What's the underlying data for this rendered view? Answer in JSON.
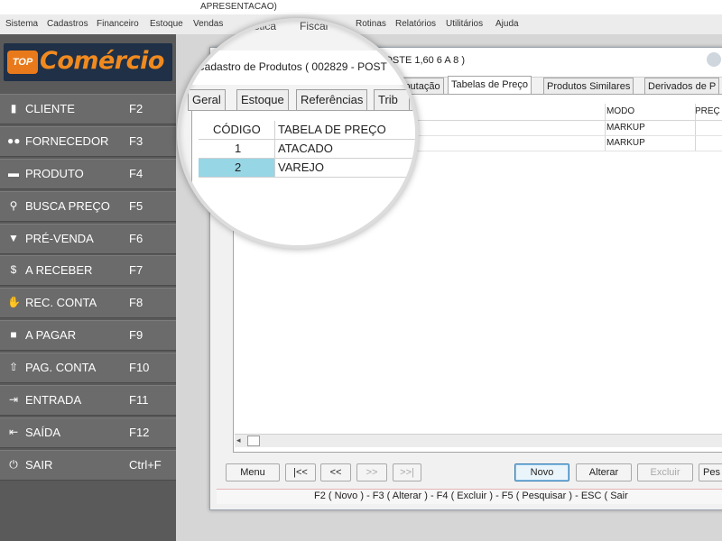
{
  "window_title_fragment": "APRESENTACAO)",
  "menubar": {
    "items": [
      "Sistema",
      "Cadastros",
      "Financeiro",
      "Estoque",
      "Vendas",
      "Logística",
      "Fiscal",
      "Rotinas",
      "Relatórios",
      "Utilitários",
      "Ajuda"
    ]
  },
  "logo": {
    "badge": "TOP",
    "brand": "Comércio"
  },
  "sidebar": {
    "items": [
      {
        "label": "CLIENTE",
        "key": "F2",
        "icon": "id-card-icon"
      },
      {
        "label": "FORNECEDOR",
        "key": "F3",
        "icon": "users-icon"
      },
      {
        "label": "PRODUTO",
        "key": "F4",
        "icon": "box-icon"
      },
      {
        "label": "BUSCA PREÇO",
        "key": "F5",
        "icon": "search-icon"
      },
      {
        "label": "PRÉ-VENDA",
        "key": "F6",
        "icon": "basket-icon"
      },
      {
        "label": "A RECEBER",
        "key": "F7",
        "icon": "dollar-icon"
      },
      {
        "label": "REC. CONTA",
        "key": "F8",
        "icon": "hand-money-icon"
      },
      {
        "label": "A PAGAR",
        "key": "F9",
        "icon": "wallet-icon"
      },
      {
        "label": "PAG. CONTA",
        "key": "F10",
        "icon": "upload-icon"
      },
      {
        "label": "ENTRADA",
        "key": "F11",
        "icon": "sign-in-icon"
      },
      {
        "label": "SAÍDA",
        "key": "F12",
        "icon": "sign-out-icon"
      },
      {
        "label": "SAIR",
        "key": "Ctrl+F",
        "icon": "power-icon"
      }
    ]
  },
  "form": {
    "title": "Cadastro de Produtos ( 002829 - POST",
    "title_right": "POSTE 1,60 6 A 8 )",
    "tabs": [
      "Geral",
      "Estoque",
      "Referências",
      "Tributação",
      "Tabelas de Preço",
      "Produtos Similares",
      "Derivados de P"
    ],
    "active_tab": "Tabelas de Preço",
    "grid": {
      "columns": [
        "CÓDIGO",
        "TABELA DE PREÇO",
        "MODO",
        "PREÇ"
      ],
      "rows": [
        {
          "codigo": "1",
          "tabela": "ATACADO",
          "modo": "MARKUP"
        },
        {
          "codigo": "2",
          "tabela": "VAREJO",
          "modo": "MARKUP"
        }
      ],
      "selected_row": 2
    },
    "buttons": {
      "menu": "Menu",
      "first": "|<<",
      "prev": "<<",
      "next": ">>",
      "last": ">>|",
      "novo": "Novo",
      "alterar": "Alterar",
      "excluir": "Excluir",
      "pesquisar": "Pes"
    },
    "status": "F2 ( Novo )  -  F3 ( Alterar )  -  F4 ( Excluir )  -  F5 ( Pesquisar )  -  ESC ( Sair"
  },
  "colors": {
    "sidebar": "#5a5a5a",
    "selected_row": "#97d6e5",
    "brand_orange": "#f08a1f"
  }
}
